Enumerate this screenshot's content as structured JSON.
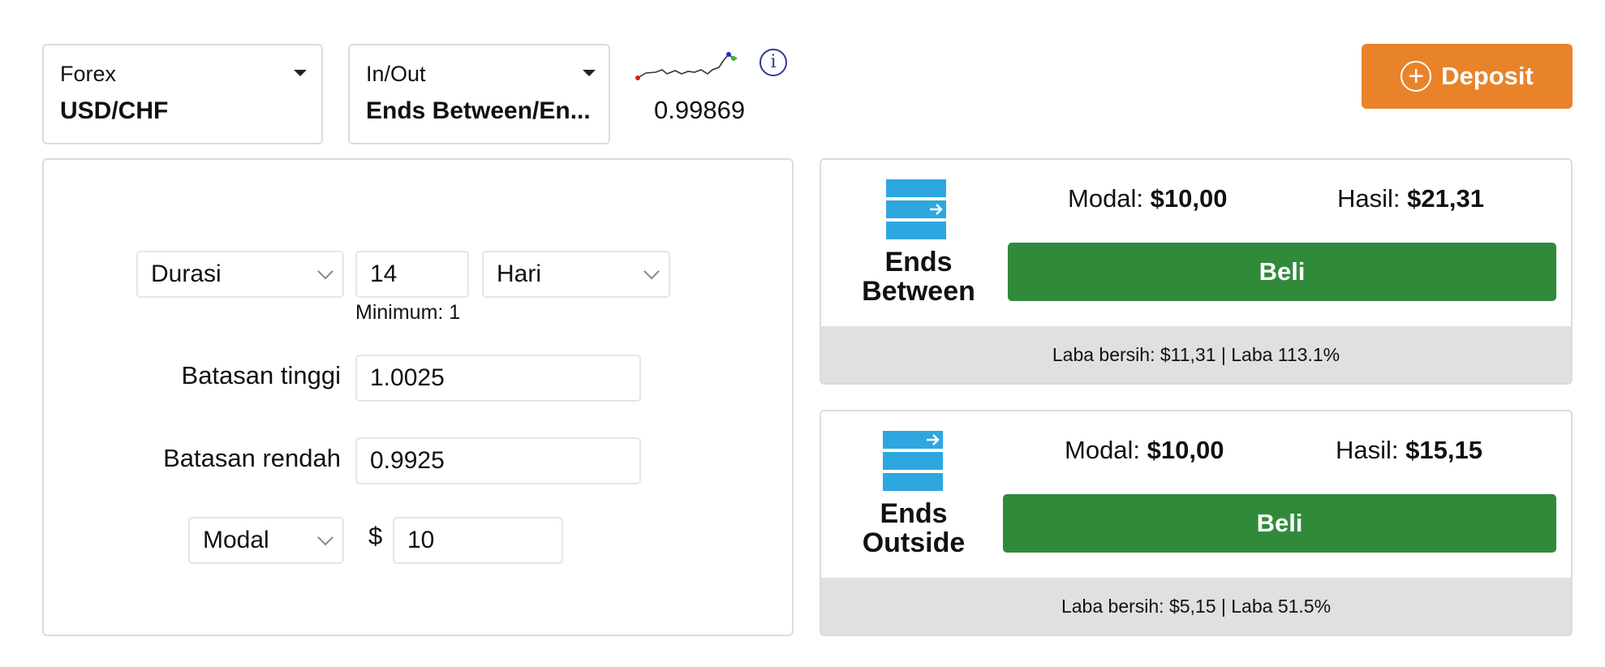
{
  "asset_selector": {
    "category": "Forex",
    "value": "USD/CHF"
  },
  "type_selector": {
    "category": "In/Out",
    "value": "Ends Between/En..."
  },
  "price": "0.99869",
  "deposit": {
    "label": "Deposit",
    "color": "#e8832a"
  },
  "form": {
    "duration": {
      "type_label": "Durasi",
      "value": "14",
      "unit": "Hari",
      "minimum_hint": "Minimum: 1"
    },
    "upper_limit": {
      "label": "Batasan tinggi",
      "value": "1.0025"
    },
    "lower_limit": {
      "label": "Batasan rendah",
      "value": "0.9925"
    },
    "stake": {
      "type_label": "Modal",
      "currency": "$",
      "value": "10"
    }
  },
  "options": [
    {
      "title_line1": "Ends",
      "title_line2": "Between",
      "modal_label": "Modal:",
      "modal_value": "$10,00",
      "hasil_label": "Hasil:",
      "hasil_value": "$21,31",
      "buy_label": "Beli",
      "footer": "Laba bersih: $11,31 | Laba 113.1%"
    },
    {
      "title_line1": "Ends",
      "title_line2": "Outside",
      "modal_label": "Modal:",
      "modal_value": "$10,00",
      "hasil_label": "Hasil:",
      "hasil_value": "$15,15",
      "buy_label": "Beli",
      "footer": "Laba bersih: $5,15 | Laba 51.5%"
    }
  ],
  "colors": {
    "buy": "#318a3a",
    "icon_blue": "#2ea7e0",
    "info": "#2b3a8f"
  },
  "icons": {
    "info": "info-icon",
    "deposit": "plus-circle-icon",
    "sparkline": "sparkline-icon"
  }
}
